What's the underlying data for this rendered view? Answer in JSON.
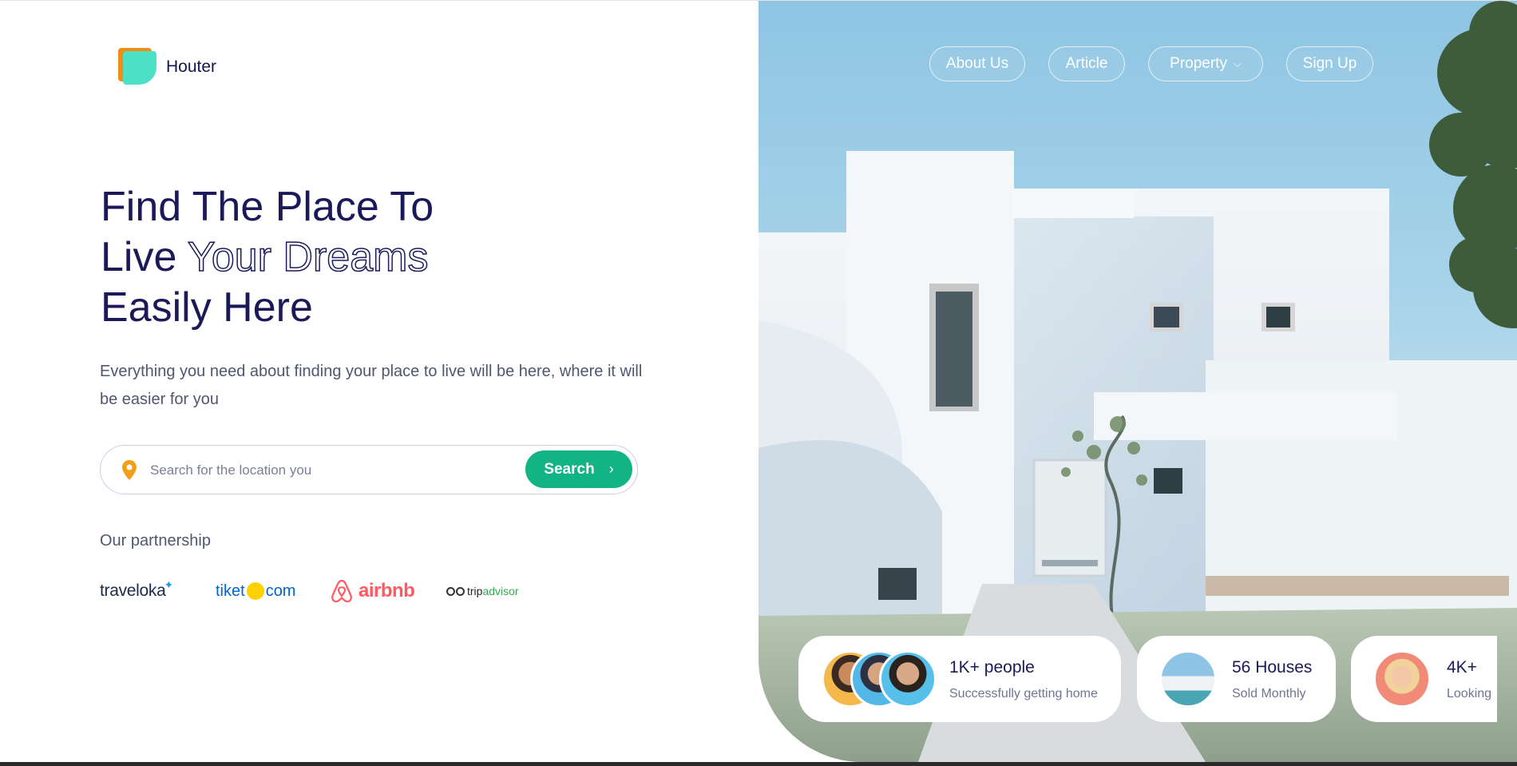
{
  "brand": {
    "name": "Houter"
  },
  "nav": {
    "about": "About Us",
    "article": "Article",
    "property": "Property",
    "signup": "Sign Up"
  },
  "hero": {
    "line1": "Find The Place To",
    "line2_prefix": "Live ",
    "line2_outline": "Your Dreams",
    "line3": "Easily Here",
    "subtext": "Everything you need about finding your place to live will be here, where it will be easier for you"
  },
  "search": {
    "placeholder": "Search for the location you",
    "button_label": "Search"
  },
  "partnership": {
    "title": "Our partnership",
    "partners": [
      {
        "name": "traveloka",
        "icon": "traveloka-bird-icon"
      },
      {
        "name_left": "tiket",
        "name_right": "com",
        "icon": "tiket-dot-icon"
      },
      {
        "name": "airbnb",
        "icon": "airbnb-icon"
      },
      {
        "name_dark": "trip",
        "name_light": "advisor",
        "icon": "tripadvisor-owl-icon"
      }
    ]
  },
  "stats": [
    {
      "value": "1K+ people",
      "label": "Successfully getting home"
    },
    {
      "value": "56 Houses",
      "label": "Sold Monthly"
    },
    {
      "value": "4K+",
      "label": "Looking"
    }
  ],
  "colors": {
    "navy": "#1b1957",
    "accent_green": "#11b482",
    "logo_orange": "#f08d16",
    "logo_teal": "#4ee0c6",
    "pin_orange": "#f2a01a"
  }
}
